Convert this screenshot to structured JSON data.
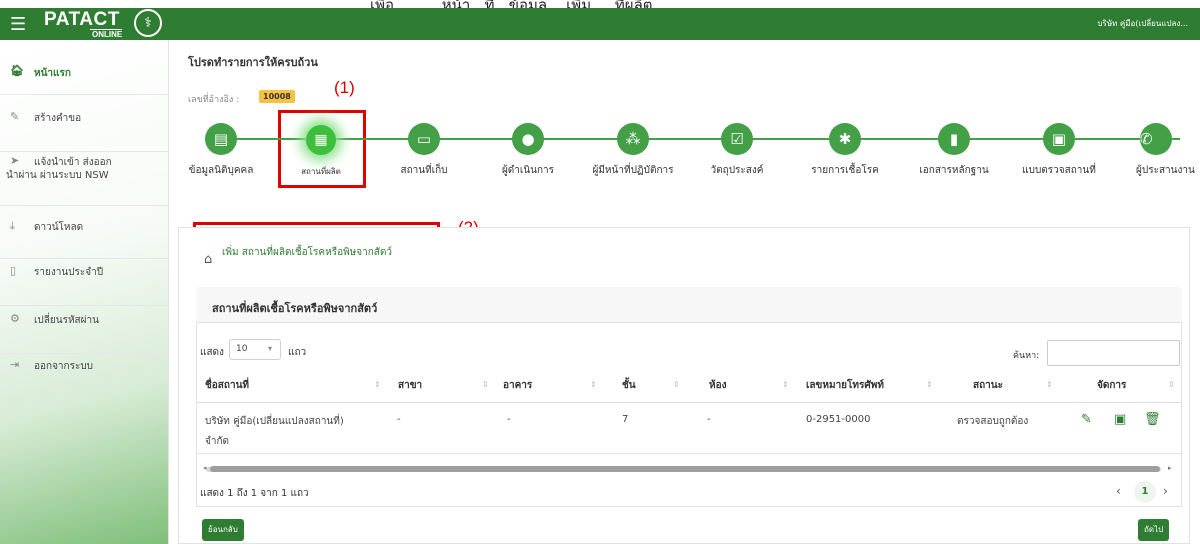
{
  "top_caption": "เพื่อ...  ......หน้า...ที่...ข้อมูล....เพิ่ม.....ที่ผลิต",
  "header": {
    "logo_main": "PATACT",
    "logo_sub": "ONLINE",
    "user_label": "บริษัท คู่มือ(เปลี่ยนแปลง...",
    "brand_color": "#2e7d32"
  },
  "sidebar": {
    "items": [
      {
        "label": "หน้าแรก",
        "icon": "home-icon"
      },
      {
        "label": "สร้างคำขอ",
        "icon": "pencil-icon"
      },
      {
        "label": "แจ้งนำเข้า ส่งออก",
        "label2": "นำผ่าน ผ่านระบบ NSW",
        "icon": "transfer-icon"
      },
      {
        "label": "ดาวน์โหลด",
        "icon": "download-icon"
      },
      {
        "label": "รายงานประจำปี",
        "icon": "file-icon"
      },
      {
        "label": "เปลี่ยนรหัสผ่าน",
        "icon": "gears-icon"
      },
      {
        "label": "ออกจากระบบ",
        "icon": "logout-icon"
      }
    ]
  },
  "main": {
    "title": "โปรดทำรายการให้ครบถ้วน",
    "ref_label": "เลขที่อ้างอิง :",
    "ref_number": "10008",
    "annotation_1": "(1)",
    "annotation_2": "(2)",
    "steps": [
      {
        "label": "ข้อมูลนิติบุคคล",
        "icon": "id-card-icon"
      },
      {
        "label": "สถานที่ผลิต",
        "icon": "building-icon",
        "active": true
      },
      {
        "label": "สถานที่เก็บ",
        "icon": "archive-icon"
      },
      {
        "label": "ผู้ดำเนินการ",
        "icon": "user-icon"
      },
      {
        "label": "ผู้มีหน้าที่ปฏิบัติการ",
        "icon": "users-icon"
      },
      {
        "label": "วัตถุประสงค์",
        "icon": "checkbox-icon"
      },
      {
        "label": "รายการเชื้อโรค",
        "icon": "virus-icon"
      },
      {
        "label": "เอกสารหลักฐาน",
        "icon": "document-icon"
      },
      {
        "label": "แบบตรวจสถานที่",
        "icon": "clipboard-icon"
      },
      {
        "label": "ผู้ประสานงาน",
        "icon": "phone-icon"
      }
    ],
    "add_link": "เพิ่ม สถานที่ผลิตเชื้อโรคหรือพิษจากสัตว์",
    "table_title": "สถานที่ผลิตเชื้อโรคหรือพิษจากสัตว์",
    "length_label_before": "แสดง",
    "length_value": "10",
    "length_label_after": "แถว",
    "search_label": "ค้นหา:",
    "columns": [
      "ชื่อสถานที่",
      "สาขา",
      "อาคาร",
      "ชั้น",
      "ห้อง",
      "เลขหมายโทรศัพท์",
      "สถานะ",
      "จัดการ"
    ],
    "rows": [
      {
        "name_line1": "บริษัท คู่มือ(เปลี่ยนแปลงสถานที่)",
        "name_line2": "จำกัด",
        "branch": "-",
        "building": "-",
        "floor": "7",
        "room": "-",
        "phone": "0-2951-0000",
        "status": "ตรวจสอบถูกต้อง"
      }
    ],
    "info": "แสดง 1 ถึง 1 จาก 1 แถว",
    "current_page": "1",
    "back_button": "ย้อนกลับ",
    "next_button": "ถัดไป"
  }
}
